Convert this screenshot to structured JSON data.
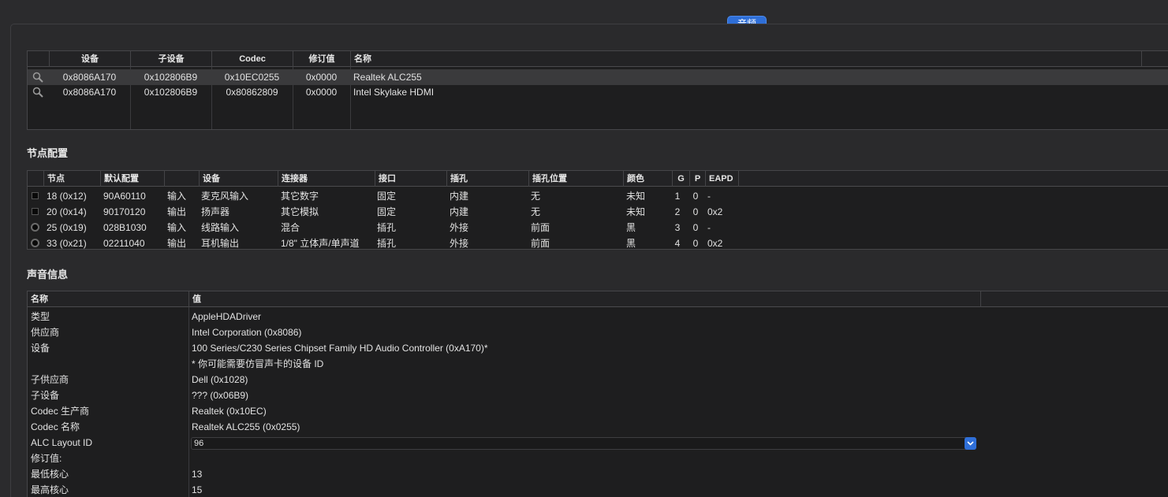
{
  "tab": {
    "label": "音频"
  },
  "devices": {
    "columns": [
      "设备",
      "子设备",
      "Codec",
      "修订值",
      "名称"
    ],
    "rows": [
      {
        "device": "0x8086A170",
        "subdevice": "0x102806B9",
        "codec": "0x10EC0255",
        "revision": "0x0000",
        "name": "Realtek ALC255"
      },
      {
        "device": "0x8086A170",
        "subdevice": "0x102806B9",
        "codec": "0x80862809",
        "revision": "0x0000",
        "name": "Intel Skylake HDMI"
      }
    ]
  },
  "nodes": {
    "title": "节点配置",
    "columns": [
      "节点",
      "默认配置",
      "",
      "设备",
      "连接器",
      "接口",
      "插孔",
      "插孔位置",
      "颜色",
      "G",
      "P",
      "EAPD"
    ],
    "rows": [
      {
        "marker": "square",
        "node": "18 (0x12)",
        "config": "90A60110",
        "dir": "输入",
        "device": "麦克风输入",
        "connector": "其它数字",
        "port": "固定",
        "jack": "内建",
        "location": "无",
        "color": "未知",
        "g": "1",
        "p": "0",
        "eapd": "-"
      },
      {
        "marker": "square",
        "node": "20 (0x14)",
        "config": "90170120",
        "dir": "输出",
        "device": "扬声器",
        "connector": "其它模拟",
        "port": "固定",
        "jack": "内建",
        "location": "无",
        "color": "未知",
        "g": "2",
        "p": "0",
        "eapd": "0x2"
      },
      {
        "marker": "circle",
        "node": "25 (0x19)",
        "config": "028B1030",
        "dir": "输入",
        "device": "线路输入",
        "connector": "混合",
        "port": "插孔",
        "jack": "外接",
        "location": "前面",
        "color": "黑",
        "g": "3",
        "p": "0",
        "eapd": "-"
      },
      {
        "marker": "circle",
        "node": "33 (0x21)",
        "config": "02211040",
        "dir": "输出",
        "device": "耳机输出",
        "connector": "1/8\" 立体声/单声道",
        "port": "插孔",
        "jack": "外接",
        "location": "前面",
        "color": "黑",
        "g": "4",
        "p": "0",
        "eapd": "0x2"
      }
    ]
  },
  "sound": {
    "title": "声音信息",
    "columns": [
      "名称",
      "值"
    ],
    "rows": [
      {
        "name": "类型",
        "value": "AppleHDADriver"
      },
      {
        "name": "供应商",
        "value": "Intel Corporation (0x8086)"
      },
      {
        "name": "设备",
        "value": "100 Series/C230 Series Chipset Family HD Audio Controller (0xA170)*"
      },
      {
        "name": "",
        "value": "* 你可能需要仿冒声卡的设备 ID"
      },
      {
        "name": "子供应商",
        "value": "Dell (0x1028)"
      },
      {
        "name": "子设备",
        "value": "??? (0x06B9)"
      },
      {
        "name": "Codec 生产商",
        "value": "Realtek (0x10EC)"
      },
      {
        "name": "Codec 名称",
        "value": "Realtek ALC255 (0x0255)"
      },
      {
        "name": "ALC Layout ID",
        "value": ""
      },
      {
        "name": "修订值:",
        "value": ""
      },
      {
        "name": "最低核心",
        "value": "13"
      },
      {
        "name": "最高核心",
        "value": "15"
      }
    ],
    "layout_id_select": "96"
  }
}
